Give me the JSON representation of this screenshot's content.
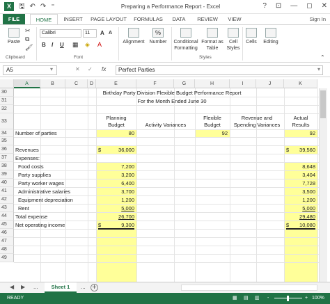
{
  "window": {
    "title": "Preparing a Performance Report - Excel",
    "controls": [
      "?",
      "⊡",
      "—",
      "◻",
      "✕"
    ]
  },
  "qat": {
    "logo": "X",
    "save_icon": "save-icon",
    "undo_icon": "undo-icon",
    "redo_icon": "redo-icon"
  },
  "ribbon": {
    "tabs": [
      "FILE",
      "HOME",
      "INSERT",
      "PAGE LAYOUT",
      "FORMULAS",
      "DATA",
      "REVIEW",
      "VIEW"
    ],
    "active_tab": "HOME",
    "sign_in": "Sign In",
    "clipboard": {
      "paste": "Paste",
      "label": "Clipboard"
    },
    "font": {
      "name": "Calibri",
      "size": "11",
      "bold": "B",
      "italic": "I",
      "underline": "U",
      "grow": "A",
      "shrink": "A",
      "label": "Font"
    },
    "alignment": {
      "label": "Alignment"
    },
    "number": {
      "symbol": "%",
      "label": "Number"
    },
    "styles": {
      "conditional": "Conditional Formatting",
      "format_table": "Format as Table",
      "cell_styles": "Cell Styles",
      "label": "Styles"
    },
    "cells": {
      "label": "Cells"
    },
    "editing": {
      "label": "Editing"
    }
  },
  "formula_bar": {
    "name_box": "A5",
    "cancel": "✕",
    "enter": "✓",
    "fx": "fx",
    "content": "Perfect Parties"
  },
  "columns": [
    "A",
    "B",
    "C",
    "D",
    "E",
    "F",
    "G",
    "H",
    "I",
    "J",
    "K"
  ],
  "rows": [
    "30",
    "31",
    "32",
    "33",
    "34",
    "35",
    "36",
    "37",
    "38",
    "39",
    "40",
    "41",
    "42",
    "43",
    "44",
    "45",
    "46",
    "47",
    "48",
    "49"
  ],
  "report": {
    "title": "Birthday Party Division Flexible Budget Performance Report",
    "subtitle": "For the Month Ended June 30",
    "headers": {
      "planning_1": "Planning",
      "planning_2": "Budget",
      "activity": "Activity Variances",
      "flexible_1": "Flexible",
      "flexible_2": "Budget",
      "revenue_1": "Revenue and",
      "revenue_2": "Spending Variances",
      "actual_1": "Actual",
      "actual_2": "Results"
    },
    "lines": [
      {
        "row": "34",
        "label": "Number of parties",
        "planning": "80",
        "flexible": "92",
        "actual": "92"
      },
      {
        "row": "36",
        "label": "Revenues",
        "planning_sym": "$",
        "planning": "36,000",
        "actual_sym": "$",
        "actual": "39,560"
      },
      {
        "row": "37",
        "label": "Expenses:"
      },
      {
        "row": "38",
        "label": "Food costs",
        "planning": "7,200",
        "actual": "8,648"
      },
      {
        "row": "39",
        "label": "Party supplies",
        "planning": "3,200",
        "actual": "3,404"
      },
      {
        "row": "40",
        "label": "Party worker wages",
        "planning": "6,400",
        "actual": "7,728"
      },
      {
        "row": "41",
        "label": "Administrative salaries",
        "planning": "3,700",
        "actual": "3,500"
      },
      {
        "row": "42",
        "label": "Equipment depreciation",
        "planning": "1,200",
        "actual": "1,200"
      },
      {
        "row": "43",
        "label": "Rent",
        "planning": "5,000",
        "actual": "5,000"
      },
      {
        "row": "44",
        "label": "Total expense",
        "planning": "26,700",
        "actual": "29,480"
      },
      {
        "row": "45",
        "label": "Net operating income",
        "planning_sym": "$",
        "planning": "9,300",
        "actual_sym": "$",
        "actual": "10,080"
      }
    ]
  },
  "sheets": {
    "active": "Sheet 1",
    "more": "...",
    "add": "+"
  },
  "status": {
    "ready": "READY",
    "zoom": "100%",
    "zoom_minus": "-",
    "zoom_plus": "+"
  },
  "colors": {
    "excel_green": "#217346",
    "highlight": "#ffff99"
  }
}
